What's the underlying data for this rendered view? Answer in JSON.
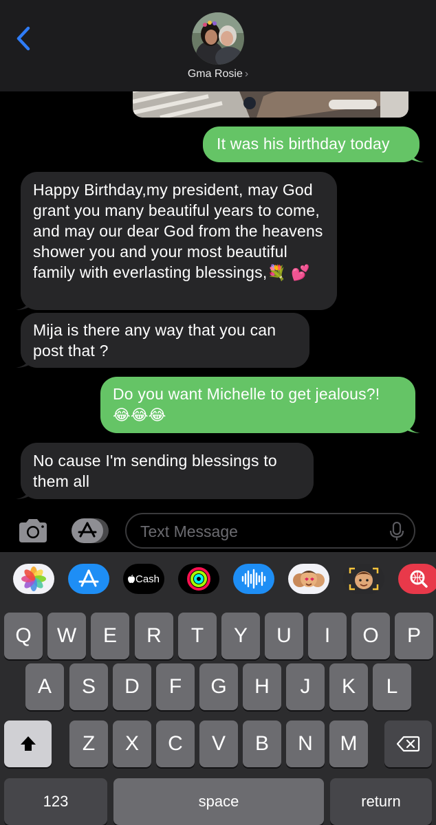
{
  "header": {
    "contact_name": "Gma Rosie",
    "chevron": "›",
    "back_icon": "chevron-left-icon"
  },
  "messages": [
    {
      "direction": "outgoing",
      "text": "It was his birthday today"
    },
    {
      "direction": "incoming",
      "text": "Happy Birthday,my president, may God grant you many beautiful years to come, and may our dear God from the heavens shower you and your most beautiful family with everlasting blessings,",
      "emoji": "💐 💕"
    },
    {
      "direction": "incoming",
      "text": "Mija is there any way that you can post that ?"
    },
    {
      "direction": "outgoing",
      "text": "Do you want Michelle to get jealous?!",
      "emoji": "😂😂😂"
    },
    {
      "direction": "incoming",
      "text": "No cause I'm sending blessings to them all"
    }
  ],
  "compose": {
    "placeholder": "Text Message",
    "camera_icon": "camera-icon",
    "apps_icon": "app-store-icon",
    "mic_icon": "microphone-icon"
  },
  "app_strip": {
    "apps": [
      "photos-icon",
      "app-store-icon",
      "apple-cash-icon",
      "activity-icon",
      "audio-message-icon",
      "memoji-stickers-icon",
      "memoji-icon",
      "image-search-icon"
    ],
    "cash_label": "Cash"
  },
  "keyboard": {
    "row1": [
      "Q",
      "W",
      "E",
      "R",
      "T",
      "Y",
      "U",
      "I",
      "O",
      "P"
    ],
    "row2": [
      "A",
      "S",
      "D",
      "F",
      "G",
      "H",
      "J",
      "K",
      "L"
    ],
    "row3": [
      "Z",
      "X",
      "C",
      "V",
      "B",
      "N",
      "M"
    ],
    "numbers_label": "123",
    "space_label": "space",
    "return_label": "return"
  },
  "colors": {
    "outgoing_bubble": "#65c466",
    "incoming_bubble": "#262628",
    "accent": "#2f7cf6",
    "keyboard_bg": "#2c2c2e",
    "key_bg": "#6c6c70"
  }
}
